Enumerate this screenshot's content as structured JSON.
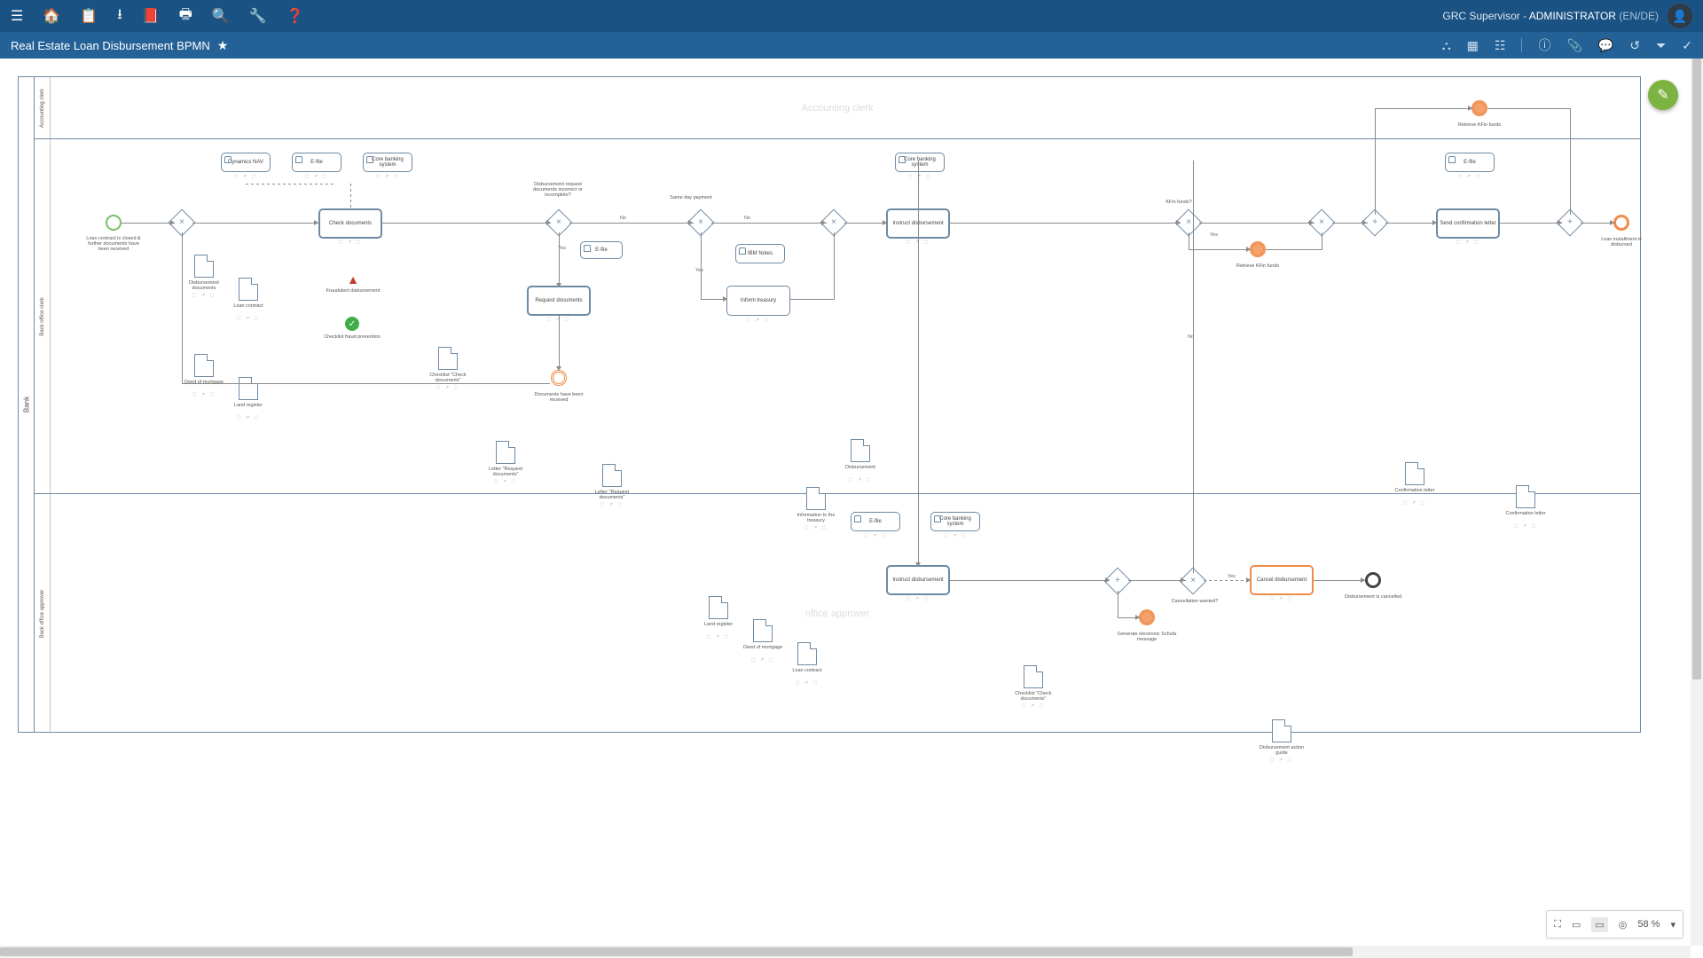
{
  "header": {
    "user_role": "GRC Supervisor",
    "user_name": "ADMINISTRATOR",
    "locale": "(EN/DE)"
  },
  "subheader": {
    "title": "Real Estate Loan Disbursement BPMN"
  },
  "pool": {
    "name": "Bank"
  },
  "lanes": {
    "l1": "Accounting clerk",
    "l2": "Back office clerk",
    "l3": "Back office approver"
  },
  "watermarks": {
    "l1": "Accounting clerk",
    "l3": "office approver"
  },
  "tasks": {
    "dynamics": "Dynamics NAV",
    "efile": "E-file",
    "corebank": "Core banking system",
    "checkdocs": "Check documents",
    "reqdocs": "Request documents",
    "efile2": "E-file",
    "ibmnotes": "IBM Notes",
    "informtreas": "Inform treasury",
    "corebank2": "Core banking system",
    "instrdis": "Instruct disbursement",
    "efile3": "E-file",
    "corebank3": "Core banking system",
    "instrdis2": "Instruct disbursement",
    "canceldis": "Cancel disbursement",
    "efile4": "E-file",
    "sendconf": "Send confirmation letter"
  },
  "events": {
    "start": "Loan contract is closed & further documents have been received",
    "docrecv": "Documents have been received",
    "retkfin": "Retrieve KFin funds",
    "retkfin2": "Retrieve KFin funds",
    "genschufa": "Generate electronic Schufa message",
    "discancel": "Disbursement is cancelled",
    "loandis": "Loan installment is disbursed"
  },
  "gateways": {
    "g_incomplete": "Disbursement request documents incorrect or incomplete?",
    "g_sameday": "Same day payment",
    "g_kfin": "KFin funds?",
    "g_cancelwant": "Cancellation wanted?"
  },
  "labels": {
    "yes": "Yes",
    "no": "No"
  },
  "data": {
    "disbdocs": "Disbursement documents",
    "loancon": "Loan contract",
    "deedmort": "Deed of mortgage",
    "landreg": "Land register",
    "chkdocs": "Checklist \"Check documents\"",
    "letreq1": "Letter \"Request documents\"",
    "letreq2": "Letter \"Request documents\"",
    "disb": "Disbursement",
    "inftreas": "Information to the treasury",
    "landreg2": "Land register",
    "deedmort2": "Deed of mortgage",
    "loancon2": "Loan contract",
    "chkdocs2": "Checklist \"Check documents\"",
    "disguide": "Disbursement action guide",
    "conflet": "Confirmation letter",
    "conflet2": "Confirmation letter"
  },
  "annotations": {
    "fraud": "Fraudulent disbursement",
    "fraudprev": "Checklist fraud prevention"
  },
  "zoom": {
    "level": "58 %"
  }
}
